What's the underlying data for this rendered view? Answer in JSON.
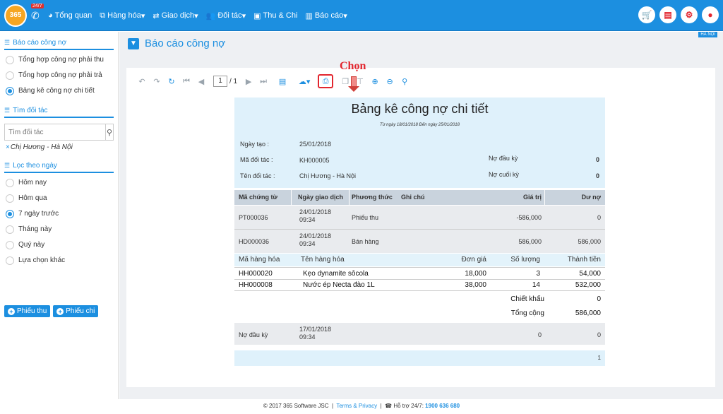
{
  "topbar": {
    "logo_text": "365",
    "hotline_badge": "24/7",
    "nav": [
      {
        "label": "Tổng quan",
        "icon": "dashboard-icon"
      },
      {
        "label": "Hàng hóa",
        "icon": "boxes-icon"
      },
      {
        "label": "Giao dịch",
        "icon": "exchange-icon"
      },
      {
        "label": "Đối tác",
        "icon": "users-icon"
      },
      {
        "label": "Thu & Chi",
        "icon": "money-icon"
      },
      {
        "label": "Báo cáo",
        "icon": "bar-chart-icon"
      }
    ],
    "actions": [
      "cart-icon",
      "clipboard-icon",
      "gear-icon",
      "user-icon"
    ]
  },
  "sidebar": {
    "report_section": {
      "title": "Báo cáo công nợ",
      "items": [
        {
          "label": "Tổng hợp công nợ phải thu",
          "selected": false
        },
        {
          "label": "Tổng hợp công nợ phải trả",
          "selected": false
        },
        {
          "label": "Bảng kê công nợ chi tiết",
          "selected": true
        }
      ]
    },
    "partner_section": {
      "title": "Tìm đối tác",
      "placeholder": "Tìm đối tác",
      "tag": "Chị Hương - Hà Nội"
    },
    "date_section": {
      "title": "Lọc theo ngày",
      "items": [
        {
          "label": "Hôm nay",
          "selected": false
        },
        {
          "label": "Hôm qua",
          "selected": false
        },
        {
          "label": "7 ngày trước",
          "selected": true
        },
        {
          "label": "Tháng này",
          "selected": false
        },
        {
          "label": "Quý này",
          "selected": false
        },
        {
          "label": "Lựa chọn khác",
          "selected": false
        }
      ]
    },
    "buttons": {
      "receipt": "Phiếu thu",
      "payment": "Phiếu chi"
    }
  },
  "main": {
    "title": "Báo cáo công nợ",
    "location_badge": "HÀ NỘI",
    "annotation": "Chọn",
    "toolbar": {
      "page_current": "1",
      "page_total": "/ 1"
    },
    "report": {
      "title": "Bảng kê công nợ chi tiết",
      "subtitle": "Từ ngày 18/01/2018 Đến ngày 25/01/2018",
      "info": {
        "created_label": "Ngày tạo :",
        "created_value": "25/01/2018",
        "partner_code_label": "Mã đối tác :",
        "partner_code_value": "KH000005",
        "partner_name_label": "Tên đối tác :",
        "partner_name_value": "Chị Hương - Hà Nội",
        "opening_label": "Nợ đầu kỳ",
        "opening_value": "0",
        "closing_label": "Nợ cuối kỳ",
        "closing_value": "0"
      },
      "columns": [
        "Mã chứng từ",
        "Ngày giao dịch",
        "Phương thức",
        "Ghi chú",
        "Giá trị",
        "Dư nợ"
      ],
      "rows": [
        {
          "code": "PT000036",
          "date": "24/01/2018",
          "time": "09:34",
          "method": "Phiếu thu",
          "value": "-586,000",
          "balance": "0"
        },
        {
          "code": "HD000036",
          "date": "24/01/2018",
          "time": "09:34",
          "method": "Bán hàng",
          "value": "586,000",
          "balance": "586,000"
        }
      ],
      "detail_columns": [
        "Mã hàng hóa",
        "Tên hàng hóa",
        "Đơn giá",
        "Số lượng",
        "Thành tiền"
      ],
      "detail_rows": [
        {
          "code": "HH000020",
          "name": "Kẹo dynamite sôcola",
          "price": "18,000",
          "qty": "3",
          "total": "54,000"
        },
        {
          "code": "HH000008",
          "name": "Nước ép Necta đào 1L",
          "price": "38,000",
          "qty": "14",
          "total": "532,000"
        }
      ],
      "discount_label": "Chiết khấu",
      "discount_value": "0",
      "sum_label": "Tổng cộng",
      "sum_value": "586,000",
      "opening_row": {
        "label": "Nợ đầu kỳ",
        "date": "17/01/2018",
        "time": "09:34",
        "value": "0",
        "balance": "0"
      },
      "page_number": "1"
    }
  },
  "footer": {
    "copyright": "© 2017 365 Software JSC",
    "sep": "|",
    "terms": "Terms & Privacy",
    "support_label": "Hỗ trợ 24/7:",
    "support_phone": "1900 636 680"
  }
}
